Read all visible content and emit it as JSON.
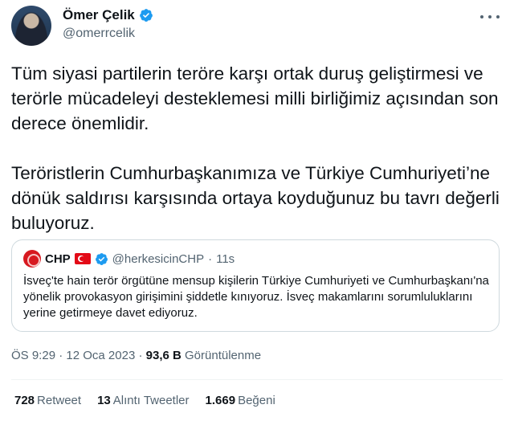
{
  "author": {
    "name": "Ömer Çelik",
    "handle": "@omerrcelik"
  },
  "tweet": {
    "paragraph1": "Tüm siyasi partilerin teröre karşı ortak duruş geliştirmesi ve terörle mücadeleyi desteklemesi milli birliğimiz açısından son derece önemlidir.",
    "paragraph2": "Teröristlerin Cumhurbaşkanımıza ve Türkiye Cumhuriyeti’ne dönük saldırısı karşısında ortaya koyduğunuz bu tavrı değerli buluyoruz."
  },
  "quote": {
    "name": "CHP",
    "handle": "@herkesicinCHP",
    "dot": "·",
    "time": "11s",
    "text": "İsveç'te hain terör örgütüne mensup kişilerin Türkiye Cumhuriyeti ve Cumhurbaşkanı'na yönelik provokasyon girişimini şiddetle kınıyoruz. İsveç makamlarını sorumluluklarını yerine getirmeye davet ediyoruz."
  },
  "meta": {
    "time": "ÖS 9:29",
    "sep": "·",
    "date": "12 Oca 2023",
    "views_count": "93,6 B",
    "views_label": "Görüntülenme"
  },
  "stats": {
    "retweets_count": "728",
    "retweets_label": "Retweet",
    "quotes_count": "13",
    "quotes_label": "Alıntı Tweetler",
    "likes_count": "1.669",
    "likes_label": "Beğeni"
  },
  "colors": {
    "verified": "#1d9bf0",
    "secondary_text": "#536471",
    "border": "#cfd9de"
  },
  "icons": [
    "verified-badge-icon",
    "more-options-icon",
    "turkey-flag-icon"
  ]
}
